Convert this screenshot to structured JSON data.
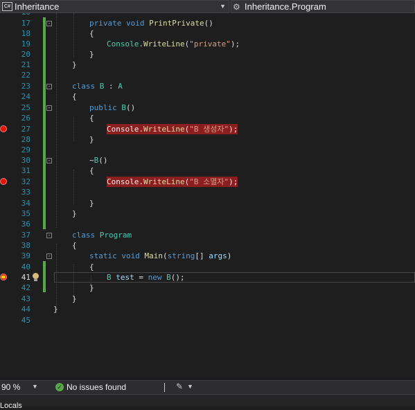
{
  "nav": {
    "file_dropdown": "Inheritance",
    "member_dropdown": "Inheritance.Program"
  },
  "colors": {
    "keyword": "#569cd6",
    "type": "#4ec9b0",
    "method": "#dcdcaa",
    "string": "#d69d85",
    "line_number": "#2b91af",
    "breakpoint": "#e51400",
    "change_bar": "#57a64a"
  },
  "editor": {
    "lines": [
      {
        "n": "17",
        "code": "private void PrintPrivate()"
      },
      {
        "n": "18",
        "code": "{"
      },
      {
        "n": "19",
        "code": "Console.WriteLine(\"private\");"
      },
      {
        "n": "20",
        "code": "}"
      },
      {
        "n": "21",
        "code": "}"
      },
      {
        "n": "22",
        "code": ""
      },
      {
        "n": "23",
        "code": "class B : A"
      },
      {
        "n": "24",
        "code": "{"
      },
      {
        "n": "25",
        "code": "public B()"
      },
      {
        "n": "26",
        "code": "{"
      },
      {
        "n": "27",
        "code": "Console.WriteLine(\"B 생성자\");",
        "breakpoint": true
      },
      {
        "n": "28",
        "code": "}"
      },
      {
        "n": "29",
        "code": ""
      },
      {
        "n": "30",
        "code": "~B()"
      },
      {
        "n": "31",
        "code": "{"
      },
      {
        "n": "32",
        "code": "Console.WriteLine(\"B 소멸자\");",
        "breakpoint": true
      },
      {
        "n": "33",
        "code": ""
      },
      {
        "n": "34",
        "code": "}"
      },
      {
        "n": "35",
        "code": "}"
      },
      {
        "n": "36",
        "code": ""
      },
      {
        "n": "37",
        "code": "class Program"
      },
      {
        "n": "38",
        "code": "{"
      },
      {
        "n": "39",
        "code": "static void Main(string[] args)"
      },
      {
        "n": "40",
        "code": "{"
      },
      {
        "n": "41",
        "code": "B test = new B();",
        "current": true
      },
      {
        "n": "42",
        "code": "}"
      },
      {
        "n": "43",
        "code": "}"
      },
      {
        "n": "44",
        "code": "}"
      },
      {
        "n": "45",
        "code": ""
      }
    ]
  },
  "status": {
    "zoom": "90 %",
    "issues": "No issues found"
  },
  "bottom_panel": {
    "title": "Locals"
  }
}
